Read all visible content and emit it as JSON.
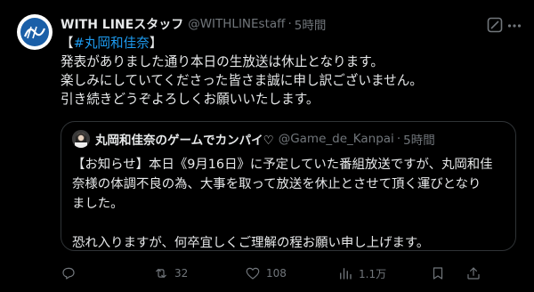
{
  "tweet": {
    "author_name": "WITH LINEスタッフ",
    "author_handle": "@WITHLINEstaff",
    "separator": "·",
    "time": "5時間",
    "lines": [
      {
        "prefix": "【",
        "hashtag": "#丸岡和佳奈",
        "suffix": "】"
      },
      {
        "text": "発表がありました通り本日の生放送は休止となります。"
      },
      {
        "text": "楽しみにしていてくださった皆さま誠に申し訳ございません。"
      },
      {
        "text": "引き続きどうぞよろしくお願いいたします。"
      }
    ]
  },
  "quote": {
    "author_name": "丸岡和佳奈のゲームでカンパイ♡",
    "author_handle": "@Game_de_Kanpai",
    "separator": "·",
    "time": "5時間",
    "lines": [
      "【お知らせ】本日《9月16日》に予定していた番組放送ですが、丸岡和佳",
      "奈様の体調不良の為、大事を取って放送を休止とさせて頂く運びとなり",
      "ました。",
      "",
      "恐れ入りますが、何卒宜しくご理解の程お願い申し上げます。"
    ]
  },
  "actions": {
    "reply_count": "",
    "retweet_count": "32",
    "like_count": "108",
    "view_count": "1.1万"
  },
  "colors": {
    "background": "#000000",
    "text": "#e7e9ea",
    "secondary": "#71767b",
    "accent": "#1d9bf0",
    "border": "#2f3336"
  },
  "icons": [
    "avatar-logo",
    "grok-icon",
    "more-icon",
    "reply-icon",
    "retweet-icon",
    "like-icon",
    "views-icon",
    "bookmark-icon",
    "share-icon"
  ]
}
